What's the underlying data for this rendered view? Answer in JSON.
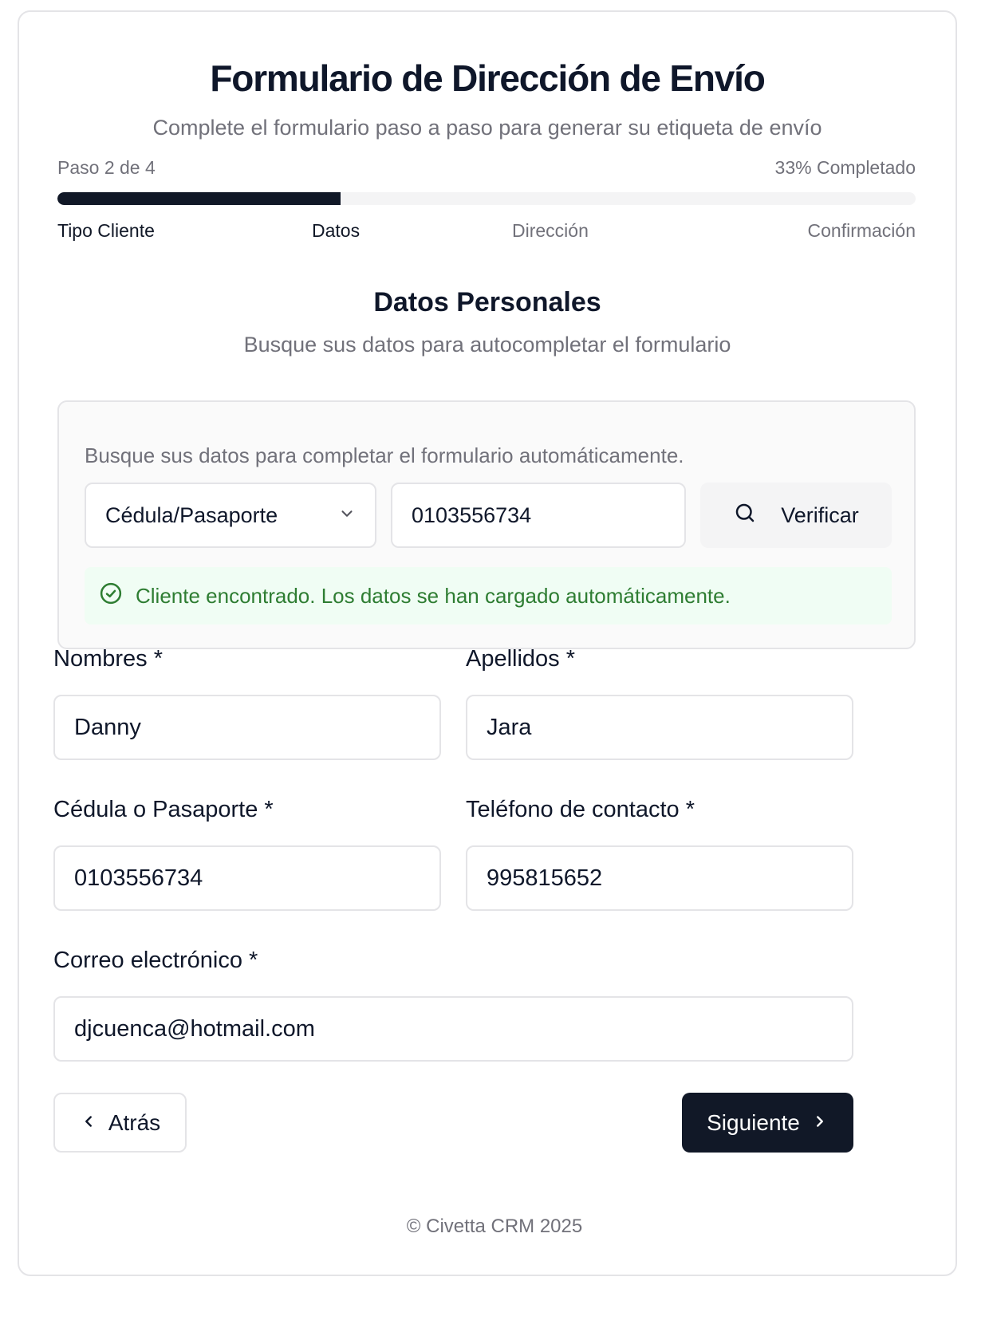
{
  "header": {
    "title": "Formulario de Dirección de Envío",
    "subtitle": "Complete el formulario paso a paso para generar su etiqueta de envío"
  },
  "progress": {
    "step_text": "Paso 2 de 4",
    "percent_text": "33% Completado",
    "fraction": 0.33,
    "steps": [
      "Tipo Cliente",
      "Datos",
      "Dirección",
      "Confirmación"
    ]
  },
  "section": {
    "title": "Datos Personales",
    "subtitle": "Busque sus datos para autocompletar el formulario"
  },
  "lookup": {
    "hint": "Busque sus datos para completar el formulario automáticamente.",
    "id_type": "Cédula/Pasaporte",
    "id_value": "0103556734",
    "verify_label": "Verificar",
    "success_message": "Cliente encontrado. Los datos se han cargado automáticamente."
  },
  "fields": {
    "nombres_label": "Nombres *",
    "nombres_value": "Danny",
    "apellidos_label": "Apellidos *",
    "apellidos_value": "Jara",
    "cedula_label": "Cédula o Pasaporte *",
    "cedula_value": "0103556734",
    "telefono_label": "Teléfono de contacto *",
    "telefono_value": "995815652",
    "email_label": "Correo electrónico *",
    "email_value": "djcuenca@hotmail.com"
  },
  "nav": {
    "back_label": "Atrás",
    "next_label": "Siguiente"
  },
  "footer": {
    "text": "© Civetta CRM 2025"
  },
  "colors": {
    "primary": "#111827",
    "muted": "#71717a",
    "success_text": "#2e7d32",
    "success_bg": "#f0fdf4"
  }
}
